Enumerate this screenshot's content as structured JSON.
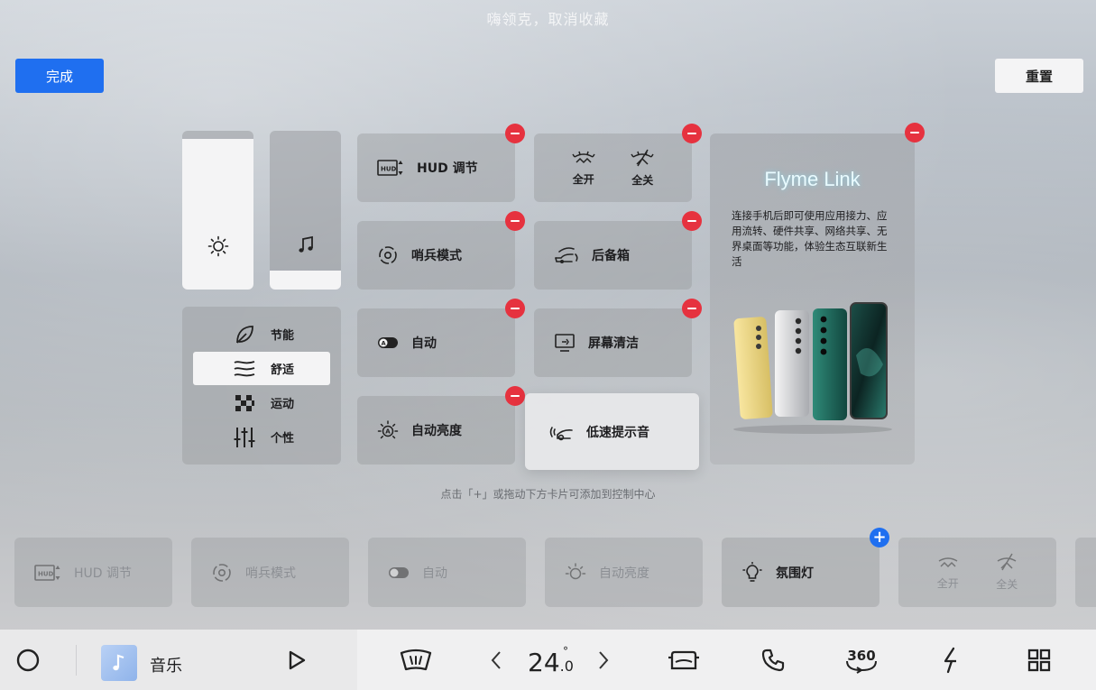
{
  "toast": "嗨领克，取消收藏",
  "header": {
    "done_label": "完成",
    "reset_label": "重置"
  },
  "controls": {
    "brightness_icon": "sun-icon",
    "volume_icon": "music-note-icon",
    "brightness_level": 0.95,
    "volume_level": 0.12,
    "drive_modes": [
      {
        "label": "节能",
        "icon": "leaf-icon",
        "selected": false
      },
      {
        "label": "舒适",
        "icon": "waves-icon",
        "selected": true
      },
      {
        "label": "运动",
        "icon": "checkered-flag-icon",
        "selected": false
      },
      {
        "label": "个性",
        "icon": "sliders-icon",
        "selected": false
      }
    ],
    "tiles": [
      {
        "label": "HUD 调节",
        "icon": "hud-icon"
      },
      {
        "label": "哨兵模式",
        "icon": "sentry-icon"
      },
      {
        "label": "自动",
        "icon": "auto-toggle-icon"
      },
      {
        "label": "自动亮度",
        "icon": "auto-brightness-icon"
      },
      {
        "label": "后备箱",
        "icon": "trunk-icon"
      },
      {
        "label": "屏幕清洁",
        "icon": "screen-clean-icon"
      },
      {
        "label": "低速提示音",
        "icon": "low-speed-sound-icon"
      }
    ],
    "windows_tile": {
      "open_label": "全开",
      "close_label": "全关"
    }
  },
  "flyme": {
    "title": "Flyme Link",
    "description": "连接手机后即可使用应用接力、应用流转、硬件共享、网络共享、无界桌面等功能，体验生态互联新生活"
  },
  "hint": "点击「+」或拖动下方卡片可添加到控制中心",
  "tray": [
    {
      "label": "HUD 调节",
      "icon": "hud-icon"
    },
    {
      "label": "哨兵模式",
      "icon": "sentry-icon"
    },
    {
      "label": "自动",
      "icon": "auto-toggle-icon"
    },
    {
      "label": "自动亮度",
      "icon": "auto-brightness-icon"
    },
    {
      "label": "氛围灯",
      "icon": "ambient-light-icon"
    }
  ],
  "tray_windows": {
    "open_label": "全开",
    "close_label": "全关"
  },
  "dock": {
    "music_label": "音乐",
    "temperature_int": "24",
    "temperature_dec": ".0",
    "temperature_unit": "°",
    "icons": [
      "home-circle-icon",
      "play-icon",
      "defrost-icon",
      "chevron-left-icon",
      "chevron-right-icon",
      "car-icon",
      "phone-icon",
      "camera-360-icon",
      "energy-icon",
      "apps-grid-icon"
    ],
    "camera_label": "360"
  },
  "colors": {
    "accent": "#1f6ff0",
    "remove": "#e6323f",
    "add": "#1f6ff0"
  }
}
